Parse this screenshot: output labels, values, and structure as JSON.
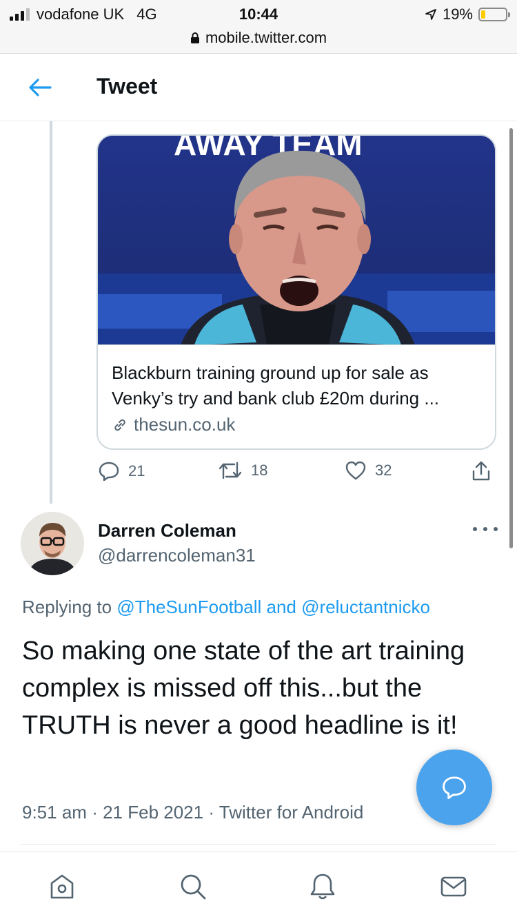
{
  "status_bar": {
    "carrier": "vodafone UK",
    "network": "4G",
    "time": "10:44",
    "battery": "19%",
    "battery_level": 0.19,
    "url": "mobile.twitter.com"
  },
  "header": {
    "title": "Tweet",
    "back_icon": "arrow-left-icon"
  },
  "quoted_card": {
    "title": "Blackburn training ground up for sale as Venky’s try and bank club £20m during ...",
    "domain": "thesun.co.uk",
    "image_text": "AWAY TEAM",
    "link_icon": "link-icon"
  },
  "actions": {
    "replies": "21",
    "retweets": "18",
    "likes": "32"
  },
  "reply_tweet": {
    "author_name": "Darren Coleman",
    "handle": "@darrencoleman31",
    "replying_prefix": "Replying to",
    "mention_1": "@TheSunFootball",
    "and_word": "and",
    "mention_2": "@reluctantnicko",
    "text": "So making one state of the art training complex is missed off this...but the TRUTH is never a good headline is it!",
    "time": "9:51 am",
    "date": "21 Feb 2021",
    "source": "Twitter for Android",
    "separator": "·"
  },
  "bottom_nav": [
    "home-icon",
    "search-icon",
    "notifications-icon",
    "messages-icon"
  ],
  "colors": {
    "accent": "#1d9bf0",
    "fab": "#4aa3ec",
    "text_primary": "#0f1419",
    "text_secondary": "#536471",
    "border": "#cfd9de"
  }
}
